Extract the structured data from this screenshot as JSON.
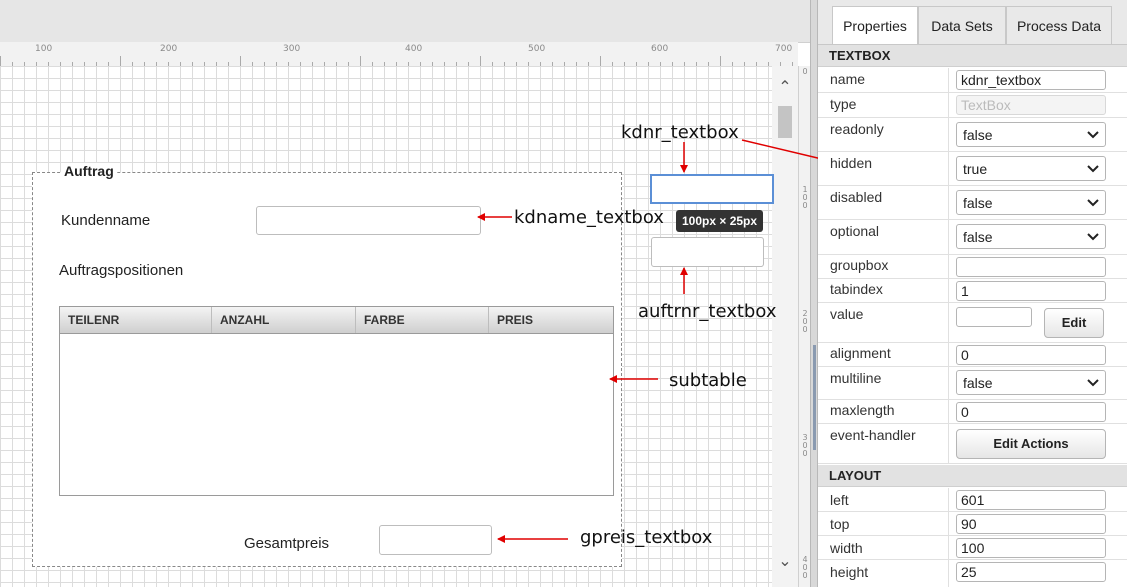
{
  "ruler": {
    "h_ticks": [
      "100",
      "200",
      "300",
      "400",
      "500",
      "600",
      "700"
    ],
    "v_ticks": [
      "0",
      "100",
      "200",
      "300",
      "400"
    ]
  },
  "form": {
    "group_title": "Auftrag",
    "kundenname_label": "Kundenname",
    "positionen_label": "Auftragspositionen",
    "gesamtpreis_label": "Gesamtpreis",
    "subtable_columns": [
      "TEILENR",
      "ANZAHL",
      "FARBE",
      "PREIS"
    ]
  },
  "size_tooltip": "100px × 25px",
  "annotations": {
    "kdnr": "kdnr_textbox",
    "kdname": "kdname_textbox",
    "auftrnr": "auftrnr_textbox",
    "subtable": "subtable",
    "gpreis": "gpreis_textbox"
  },
  "colors": {
    "arrow": "#e00000",
    "selection": "#5b8fd6"
  },
  "panel": {
    "tabs": [
      "Properties",
      "Data Sets",
      "Process Data"
    ],
    "active_tab": "Properties",
    "section_textbox": "TEXTBOX",
    "section_layout": "LAYOUT",
    "props": {
      "name": {
        "label": "name",
        "value": "kdnr_textbox"
      },
      "type": {
        "label": "type",
        "value": "TextBox"
      },
      "readonly": {
        "label": "readonly",
        "value": "false"
      },
      "hidden": {
        "label": "hidden",
        "value": "true"
      },
      "disabled": {
        "label": "disabled",
        "value": "false"
      },
      "optional": {
        "label": "optional",
        "value": "false"
      },
      "groupbox": {
        "label": "groupbox",
        "value": ""
      },
      "tabindex": {
        "label": "tabindex",
        "value": "1"
      },
      "value": {
        "label": "value",
        "value": "",
        "button": "Edit"
      },
      "alignment": {
        "label": "alignment",
        "value": "0"
      },
      "multiline": {
        "label": "multiline",
        "value": "false"
      },
      "maxlength": {
        "label": "maxlength",
        "value": "0"
      },
      "event_handler": {
        "label": "event-handler",
        "button": "Edit Actions"
      }
    },
    "layout": {
      "left": {
        "label": "left",
        "value": "601"
      },
      "top": {
        "label": "top",
        "value": "90"
      },
      "width": {
        "label": "width",
        "value": "100"
      },
      "height": {
        "label": "height",
        "value": "25"
      }
    }
  }
}
